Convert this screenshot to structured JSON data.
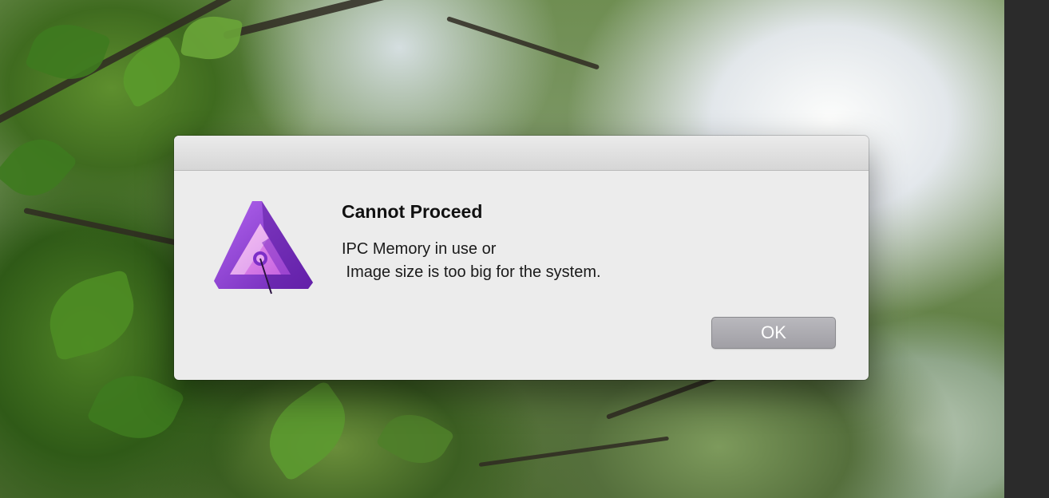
{
  "dialog": {
    "title": "Cannot Proceed",
    "message": "IPC Memory in use or\n Image size is too big for the system.",
    "ok_label": "OK",
    "icon": "affinity-photo-icon"
  },
  "colors": {
    "dialog_background": "#ececec",
    "button_background": "#a6a5aa",
    "icon_purple": "#8a3fd1",
    "icon_pink": "#e98ae9"
  }
}
